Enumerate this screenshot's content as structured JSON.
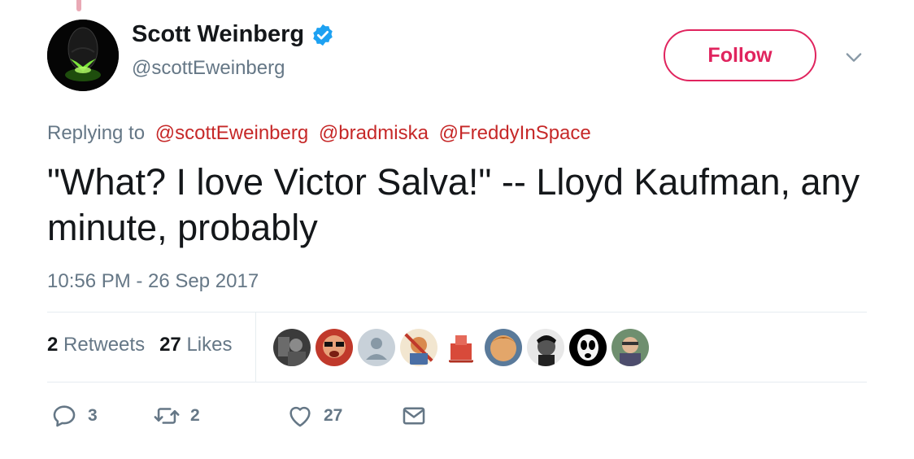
{
  "author": {
    "display_name": "Scott Weinberg",
    "handle": "@scottEweinberg",
    "verified": true,
    "avatar_icon": "alien-egg-avatar"
  },
  "follow_button": {
    "label": "Follow",
    "color": "#e0245e"
  },
  "replying": {
    "prefix": "Replying to",
    "mentions": [
      "@scottEweinberg",
      "@bradmiska",
      "@FreddyInSpace"
    ]
  },
  "tweet": {
    "text": "\"What? I love Victor Salva!\" -- Lloyd Kaufman, any minute, probably",
    "timestamp": "10:56 PM - 26 Sep 2017"
  },
  "stats": {
    "retweets_count": "2",
    "retweets_label": "Retweets",
    "likes_count": "27",
    "likes_label": "Likes"
  },
  "actions": {
    "reply_count": "3",
    "retweet_count": "2",
    "like_count": "27"
  },
  "colors": {
    "text": "#14171a",
    "muted": "#657786",
    "mention": "#c62828",
    "verified": "#1da1f2",
    "border": "#e6ecf0"
  }
}
